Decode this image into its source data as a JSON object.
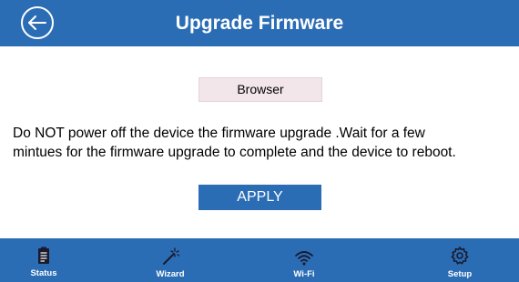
{
  "header": {
    "title": "Upgrade Firmware",
    "back_icon": "back-arrow-icon"
  },
  "upload": {
    "browser_label": "Browser"
  },
  "message": {
    "line1": "Do NOT power off the device the firmware upgrade .Wait for a few",
    "line2": "mintues for the firmware upgrade to complete and the device to reboot."
  },
  "actions": {
    "apply_label": "APPLY"
  },
  "nav": {
    "items": [
      {
        "label": "Status",
        "icon": "clipboard-icon"
      },
      {
        "label": "Wizard",
        "icon": "magic-wand-icon"
      },
      {
        "label": "Wi-Fi",
        "icon": "wifi-icon"
      },
      {
        "label": "Setup",
        "icon": "gear-icon"
      }
    ]
  },
  "colors": {
    "primary": "#2b6db5",
    "browser_button_bg": "#f3e6ea",
    "text": "#000000",
    "background": "#ffffff"
  }
}
